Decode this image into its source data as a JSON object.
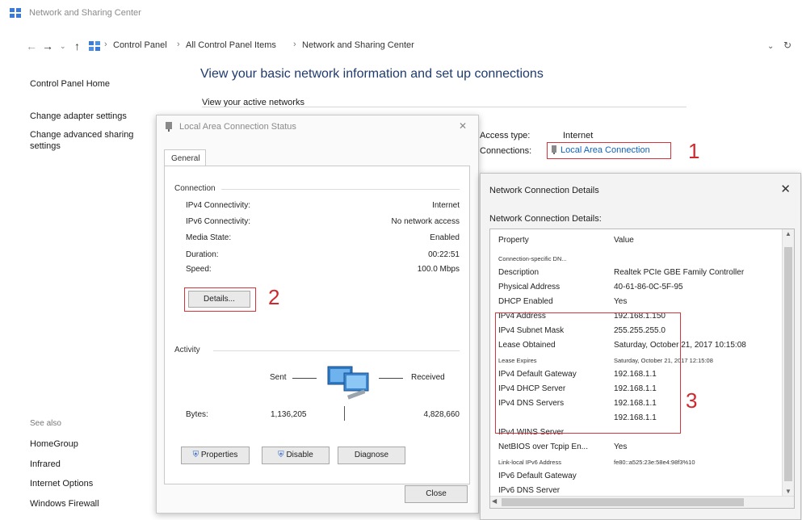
{
  "window": {
    "title": "Network and Sharing Center"
  },
  "addressbar": {
    "breadcrumbs": [
      "Control Panel",
      "All Control Panel Items",
      "Network and Sharing Center"
    ]
  },
  "left_pane": {
    "home": "Control Panel Home",
    "links": [
      "Change adapter settings",
      "Change advanced sharing settings"
    ],
    "see_also_title": "See also",
    "see_also": [
      "HomeGroup",
      "Infrared",
      "Internet Options",
      "Windows Firewall"
    ]
  },
  "main": {
    "heading": "View your basic network information and set up connections",
    "active_networks": "View your active networks",
    "access_type_label": "Access type:",
    "access_type_value": "Internet",
    "connections_label": "Connections:",
    "connection_link": "Local Area Connection"
  },
  "annotations": {
    "n1": "1",
    "n2": "2",
    "n3": "3",
    "color": "#d9343c"
  },
  "status_dialog": {
    "title": "Local Area Connection Status",
    "tab": "General",
    "connection_group": "Connection",
    "rows": [
      {
        "k": "IPv4 Connectivity:",
        "v": "Internet"
      },
      {
        "k": "IPv6 Connectivity:",
        "v": "No network access"
      },
      {
        "k": "Media State:",
        "v": "Enabled"
      },
      {
        "k": "Duration:",
        "v": "00:22:51"
      },
      {
        "k": "Speed:",
        "v": "100.0 Mbps"
      }
    ],
    "details_button": "Details...",
    "activity_group": "Activity",
    "sent_label": "Sent",
    "received_label": "Received",
    "bytes_label": "Bytes:",
    "bytes_sent": "1,136,205",
    "bytes_received": "4,828,660",
    "buttons": [
      "Properties",
      "Disable",
      "Diagnose"
    ],
    "close_button": "Close"
  },
  "details_dialog": {
    "title": "Network Connection Details",
    "subtitle": "Network Connection Details:",
    "col_property": "Property",
    "col_value": "Value",
    "rows": [
      {
        "p": "Connection-specific DN...",
        "v": "",
        "small": true
      },
      {
        "p": "Description",
        "v": "Realtek PCIe GBE Family Controller"
      },
      {
        "p": "Physical Address",
        "v": "40-61-86-0C-5F-95"
      },
      {
        "p": "DHCP Enabled",
        "v": "Yes"
      },
      {
        "p": "IPv4 Address",
        "v": "192.168.1.150"
      },
      {
        "p": "IPv4 Subnet Mask",
        "v": "255.255.255.0"
      },
      {
        "p": "Lease Obtained",
        "v": "Saturday, October 21, 2017 10:15:08"
      },
      {
        "p": "Lease Expires",
        "v": "Saturday, October 21, 2017 12:15:08",
        "small": true
      },
      {
        "p": "IPv4 Default Gateway",
        "v": "192.168.1.1"
      },
      {
        "p": "IPv4 DHCP Server",
        "v": "192.168.1.1"
      },
      {
        "p": "IPv4 DNS Servers",
        "v": "192.168.1.1"
      },
      {
        "p": "",
        "v": "192.168.1.1"
      },
      {
        "p": "IPv4 WINS Server",
        "v": ""
      },
      {
        "p": "NetBIOS over Tcpip En...",
        "v": "Yes"
      },
      {
        "p": "Link-local IPv6 Address",
        "v": "fe80::a525:23e:58e4:98f3%10",
        "small": true
      },
      {
        "p": "IPv6 Default Gateway",
        "v": ""
      },
      {
        "p": "IPv6 DNS Server",
        "v": ""
      }
    ]
  }
}
